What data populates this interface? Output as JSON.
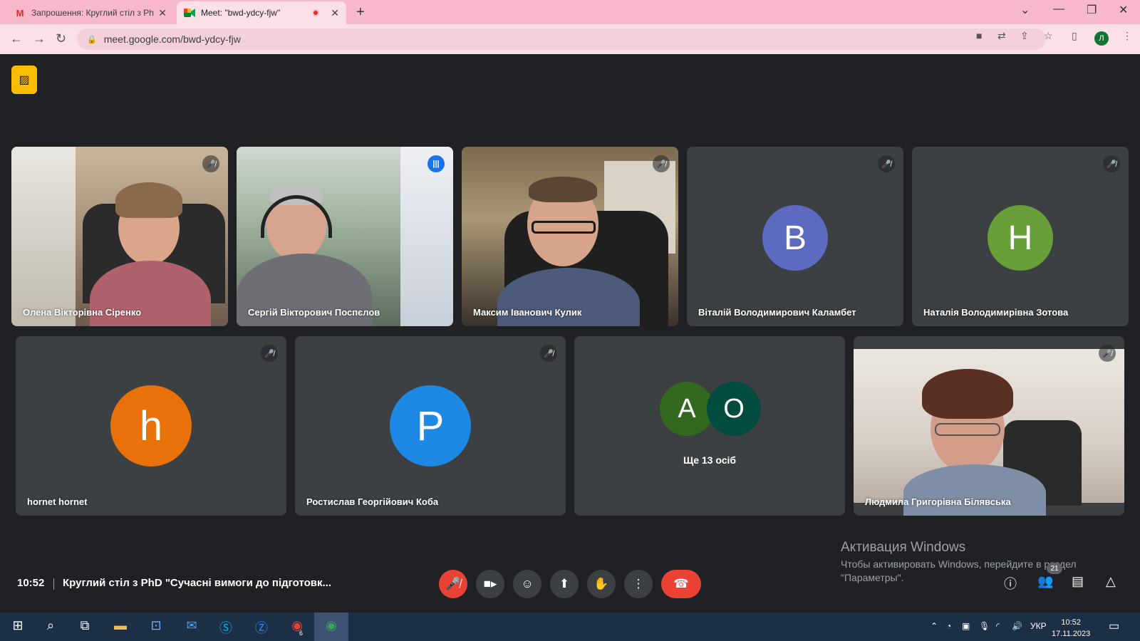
{
  "browser": {
    "tabs": [
      {
        "title": "Запрошення: Круглий стіл з PhD",
        "favicon": "gmail-icon",
        "active": false
      },
      {
        "title": "Meet: \"bwd-ydcy-fjw\"",
        "favicon": "meet-icon",
        "active": true
      }
    ],
    "url": "meet.google.com/bwd-ydcy-fjw",
    "profile_initial": "Л"
  },
  "participants_top": [
    {
      "name": "Олена Вікторівна Сіренко",
      "type": "video",
      "muted": true
    },
    {
      "name": "Сергій Вікторович Поспєлов",
      "type": "video",
      "muted": false,
      "speaking": true
    },
    {
      "name": "Максим Іванович Кулик",
      "type": "video",
      "muted": true
    },
    {
      "name": "Віталій Володимирович Каламбет",
      "type": "avatar",
      "initial": "В",
      "color": "#5c6bc0",
      "muted": true
    },
    {
      "name": "Наталія Володимирівна Зотова",
      "type": "avatar",
      "initial": "Н",
      "color": "#689f38",
      "muted": true
    }
  ],
  "participants_bottom": [
    {
      "name": "hornet hornet",
      "type": "avatar",
      "initial": "h",
      "color": "#e8710a",
      "muted": true
    },
    {
      "name": "Ростислав Георгійович Коба",
      "type": "avatar",
      "initial": "Р",
      "color": "#1e88e5",
      "muted": true
    },
    {
      "type": "more",
      "initials": [
        "А",
        "О"
      ],
      "colors": [
        "#33691e",
        "#004d40"
      ],
      "label": "Ще 13 осіб"
    },
    {
      "name": "Людмила Григорівна Білявська",
      "type": "video",
      "muted": true
    }
  ],
  "footer": {
    "time": "10:52",
    "meeting_title": "Круглий стіл з PhD \"Сучасні вимоги до підготовк...",
    "people_count": "21"
  },
  "activation": {
    "title": "Активация Windows",
    "line1": "Чтобы активировать Windows, перейдите в раздел",
    "line2": "\"Параметры\"."
  },
  "taskbar": {
    "chrome_badge": "6",
    "lang": "УКР",
    "time": "10:52",
    "date": "17.11.2023"
  }
}
